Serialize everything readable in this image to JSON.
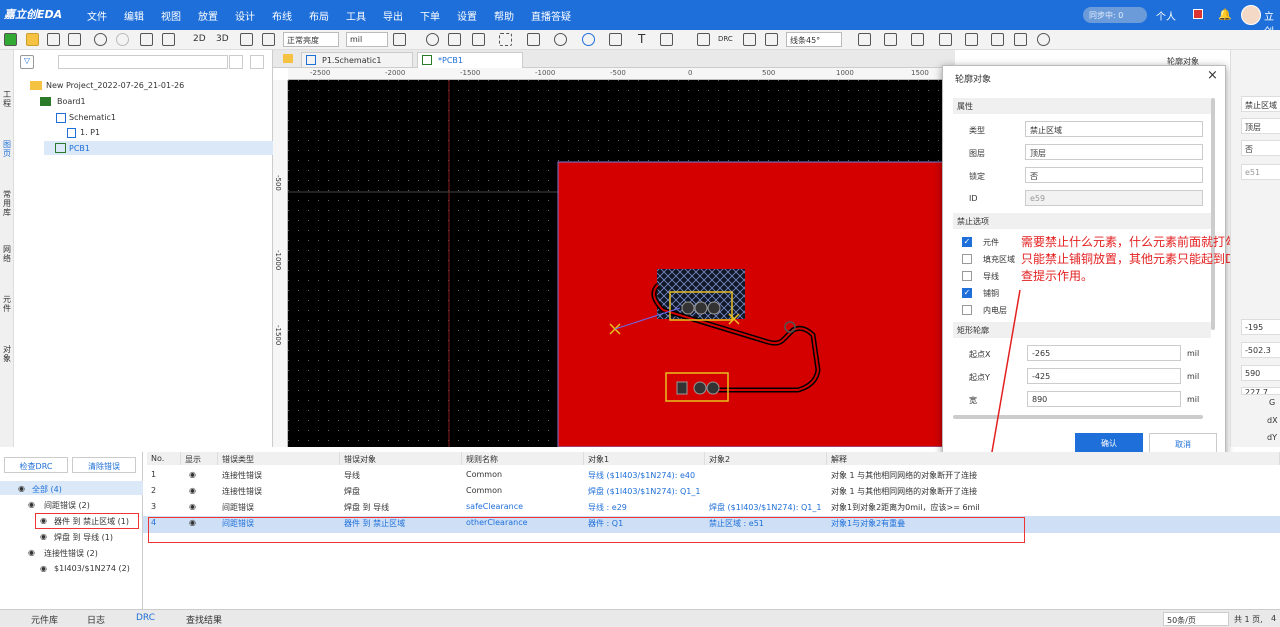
{
  "menubar": {
    "logo": "嘉立创EDA",
    "items": [
      "文件",
      "编辑",
      "视图",
      "放置",
      "设计",
      "布线",
      "布局",
      "工具",
      "导出",
      "下单",
      "设置",
      "帮助",
      "直播答疑"
    ],
    "sync": "同步中: 0",
    "user": "个人",
    "extra": "立创"
  },
  "toolbar": {
    "view2d": "2D",
    "view3d": "3D",
    "brightness": "正常亮度",
    "unit": "mil",
    "route_mode": "线条45°"
  },
  "left_tabs": [
    "工程",
    "图页",
    "常用库",
    "网络",
    "元件",
    "对象"
  ],
  "tree": {
    "project": "New Project_2022-07-26_21-01-26",
    "board": "Board1",
    "schematic": "Schematic1",
    "sheet": "1. P1",
    "pcb": "PCB1"
  },
  "doc_tabs": [
    "P1.Schematic1",
    "*PCB1"
  ],
  "ruler_ticks": [
    "-2500",
    "-2000",
    "-1500",
    "-1000",
    "-500",
    "0",
    "500",
    "1000",
    "1500"
  ],
  "vruler_ticks": [
    "-500",
    "-1000",
    "-1500"
  ],
  "dialog": {
    "title": "轮廓对象",
    "close": "×",
    "section_props": "属性",
    "type_label": "类型",
    "type_value": "禁止区域",
    "layer_label": "图层",
    "layer_value": "顶层",
    "lock_label": "锁定",
    "lock_value": "否",
    "id_label": "ID",
    "id_value": "e59",
    "section_forbid": "禁止选项",
    "options": [
      {
        "label": "元件",
        "checked": true
      },
      {
        "label": "填充区域",
        "checked": false
      },
      {
        "label": "导线",
        "checked": false
      },
      {
        "label": "铺铜",
        "checked": true
      },
      {
        "label": "内电层",
        "checked": false
      }
    ],
    "section_rect": "矩形轮廓",
    "startx_label": "起点X",
    "startx_value": "-265",
    "starty_label": "起点Y",
    "starty_value": "-425",
    "width_label": "宽",
    "width_value": "890",
    "unit": "mil",
    "ok": "确认",
    "cancel": "取消"
  },
  "annotation": "需要禁止什么元素，什么元素前面就打勾目前只能禁止铺铜放置，其他元素只能起到DRC检查提示作用。",
  "right_panel": {
    "title": "轮廓对象",
    "values": [
      "禁止区域",
      "顶层",
      "否",
      "e51",
      "-195",
      "-502.3",
      "590",
      "227.7"
    ],
    "coords": [
      "G",
      "dX",
      "dY"
    ]
  },
  "drc": {
    "check_btn": "检查DRC",
    "clear_btn": "清除错误",
    "tree": [
      {
        "label": "全部 (4)"
      },
      {
        "label": "间距错误 (2)"
      },
      {
        "label": "器件 到 禁止区域 (1)"
      },
      {
        "label": "焊盘 到 导线 (1)"
      },
      {
        "label": "连接性错误 (2)"
      },
      {
        "label": "$1I403/$1N274 (2)"
      }
    ],
    "headers": [
      "No.",
      "显示",
      "错误类型",
      "错误对象",
      "规则名称",
      "对象1",
      "对象2",
      "解释"
    ],
    "rows": [
      {
        "no": "1",
        "type": "连接性错误",
        "obj": "导线",
        "rule": "Common",
        "o1": "导线 ($1I403/$1N274): e40",
        "o2": "",
        "exp": "对象 1 与其他相同网络的对象断开了连接"
      },
      {
        "no": "2",
        "type": "连接性错误",
        "obj": "焊盘",
        "rule": "Common",
        "o1": "焊盘 ($1I403/$1N274): Q1_1",
        "o2": "",
        "exp": "对象 1 与其他相同网络的对象断开了连接"
      },
      {
        "no": "3",
        "type": "间距错误",
        "obj": "焊盘 到 导线",
        "rule": "safeClearance",
        "o1": "导线 : e29",
        "o2": "焊盘 ($1I403/$1N274): Q1_1",
        "exp": "对象1到对象2距离为0mil，应该>= 6mil"
      },
      {
        "no": "4",
        "type": "间距错误",
        "obj": "器件 到 禁止区域",
        "rule": "otherClearance",
        "o1": "器件 : Q1",
        "o2": "禁止区域 : e51",
        "exp": "对象1与对象2有重叠"
      }
    ]
  },
  "bottom_tabs": [
    "元件库",
    "日志",
    "DRC",
    "查找结果"
  ],
  "pager": {
    "per_page": "50条/页",
    "total": "共 1 页,",
    "page": "4"
  },
  "colors": {
    "accent": "#1e6fd9",
    "board_red": "#d40000",
    "annotation_red": "#e32020"
  }
}
